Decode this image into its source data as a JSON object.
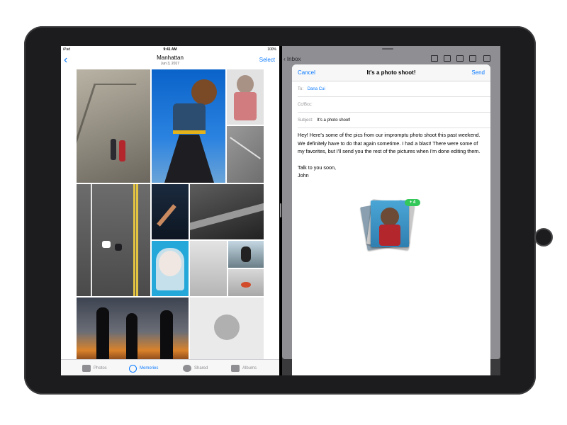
{
  "photos": {
    "status": {
      "device": "iPad",
      "time": "9:41 AM",
      "battery": "100%"
    },
    "nav": {
      "title": "Manhattan",
      "subtitle": "Jun 3, 2017",
      "select": "Select"
    },
    "tabs": [
      {
        "label": "Photos",
        "icon": "photos-icon"
      },
      {
        "label": "Memories",
        "icon": "memories-icon",
        "active": true
      },
      {
        "label": "Shared",
        "icon": "cloud-icon"
      },
      {
        "label": "Albums",
        "icon": "albums-icon"
      }
    ]
  },
  "mail": {
    "toolbar": {
      "inbox": "Inbox"
    },
    "compose": {
      "cancel": "Cancel",
      "title": "It's a photo shoot!",
      "send": "Send",
      "to_label": "To:",
      "to_value": "Dana Cui",
      "ccbcc_label": "Cc/Bcc:",
      "subject_label": "Subject:",
      "subject_value": "It's a photo shoot!",
      "body_p1": "Hey! Here's some of the pics from our impromptu photo shoot this past weekend. We definitely have to do that again sometime. I had a blast! There were some of my favorites, but I'll send you the rest of the pictures when I'm done editing them.",
      "body_p2a": "Talk to you soon,",
      "body_p2b": "John",
      "attachment_badge": "+ 4"
    }
  }
}
